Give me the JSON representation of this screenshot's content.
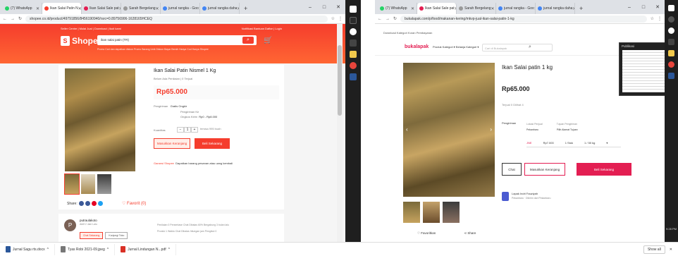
{
  "colors": {
    "shopee": "#f53d2d",
    "bukalapak": "#e31e52"
  },
  "left": {
    "tabs": [
      {
        "label": "(7) WhatsApp",
        "fav": "#25d366"
      },
      {
        "label": "Ikan Salai Patin N",
        "fav": "#f53d2d",
        "active": true
      },
      {
        "label": "Ikan Salai Sale pat",
        "fav": "#e31e52"
      },
      {
        "label": "Sarah Bergelang",
        "fav": "#999999"
      },
      {
        "label": "jurnal rangka - Goo",
        "fav": "#4285f4"
      },
      {
        "label": "jurnal rangka daha",
        "fav": "#4285f4"
      }
    ],
    "url": "shopee.co.id/product/49791856/8456190940/rsrc=0.89756906-1628165HCEQ",
    "header_top_left": "Seller Centre | Mulai Jual | Download | Ikuti kami",
    "header_top_right": "Notifikasi  Bantuan  Daftar | Login",
    "logo": "Shopee",
    "search": "ikan salai patin (TR)",
    "header_links": "Promo   Cari dan dapatkan diskon   Promo   Barang Unik   Diskon   Bayar Bersih   Hanya Cod   Hanya Shopee",
    "product": {
      "title": "Ikan Salai Patin Nismel 1 Kg",
      "meta": "Belum Ada Penilaian  |  0 Terjual",
      "price": "Rp65.000",
      "shipping_label": "Pengiriman",
      "shipping_value": "Gratis Ongkir  ",
      "shipping_to": "Pengiriman Ke",
      "shipping_cost_label": "Ongkos Kirim",
      "shipping_cost": "Rp0 - Rp8.000",
      "qty_label": "Kuantitas",
      "qty": "1",
      "qty_stock": "tersisa 995 buah",
      "add_to_cart": "Masukkan Keranjang",
      "buy_now": "Beli Sekarang",
      "guarantee": "Garansi Shopee",
      "guarantee_text": "Dapatkan barang pesanan atau uang kembali",
      "share": "Share:",
      "like": "♡ Favorit (0)"
    },
    "shop": {
      "avatar": "P",
      "name": "putraulakoto",
      "status": "Aktif 2 Jam Lalu",
      "chat": "Chat Sekarang",
      "visit": "Kunjungi Toko",
      "stats": [
        "Penilaian  0     Persentase Chat Dibalas   60%     Bergabung   3 bulan lalu",
        "Produk   1       Waktu Chat Dibalas   hitungan jam     Pengikut  0"
      ]
    }
  },
  "right": {
    "url": "bukalapak.com/p/food/makanan-kering/mkvp-jual-ikan-salai-patin-1-kg",
    "bookmarks": "Download   Kategori   Koran   Pembayaran",
    "logo": "bukalapak",
    "menu": "Produk Kategori ▾  Belanja Kategori ▾",
    "search_placeholder": "Cari di Bukalapak",
    "product": {
      "title": "Ikan Salai patin 1 kg",
      "price": "Rp65.000",
      "sold": "Terjual 0   Dilihat 4",
      "shipping_label": "Pengiriman",
      "ship_col1": "Lokasi Penjual",
      "ship_col1_val": "Pekanbaru",
      "ship_col2": "Tujuan Pengiriman",
      "ship_col2_val": "Pilih Alamat Tujuan",
      "courier": "JNE",
      "courier_price": "Rp7.000",
      "qty": "1 Stok",
      "unit": "1 / 50 kg",
      "chat": "Chat",
      "add_to_cart": "Masukkan Keranjang",
      "buy_now": "Beli Sekarang",
      "wishlist": "Favoritkan",
      "share": "Share"
    },
    "seller": {
      "name": "Lapak Indri Fauziyah",
      "detail": "Pekanbaru · Dikirim dari Pekanbaru"
    }
  },
  "popup": {
    "title": "Publikasi"
  },
  "taskbar": {
    "clock": "9:28 PM"
  },
  "downloads": [
    {
      "name": "Jurnal Sagu rts.docx",
      "color": "#2b579a"
    },
    {
      "name": "Tyas Robi 2021-09.jpeg",
      "color": "#777777"
    },
    {
      "name": "Jurnal Lindungan N...pdf",
      "color": "#d93025"
    }
  ],
  "downloads_show_all": "Show all",
  "downloads_close": "✕"
}
